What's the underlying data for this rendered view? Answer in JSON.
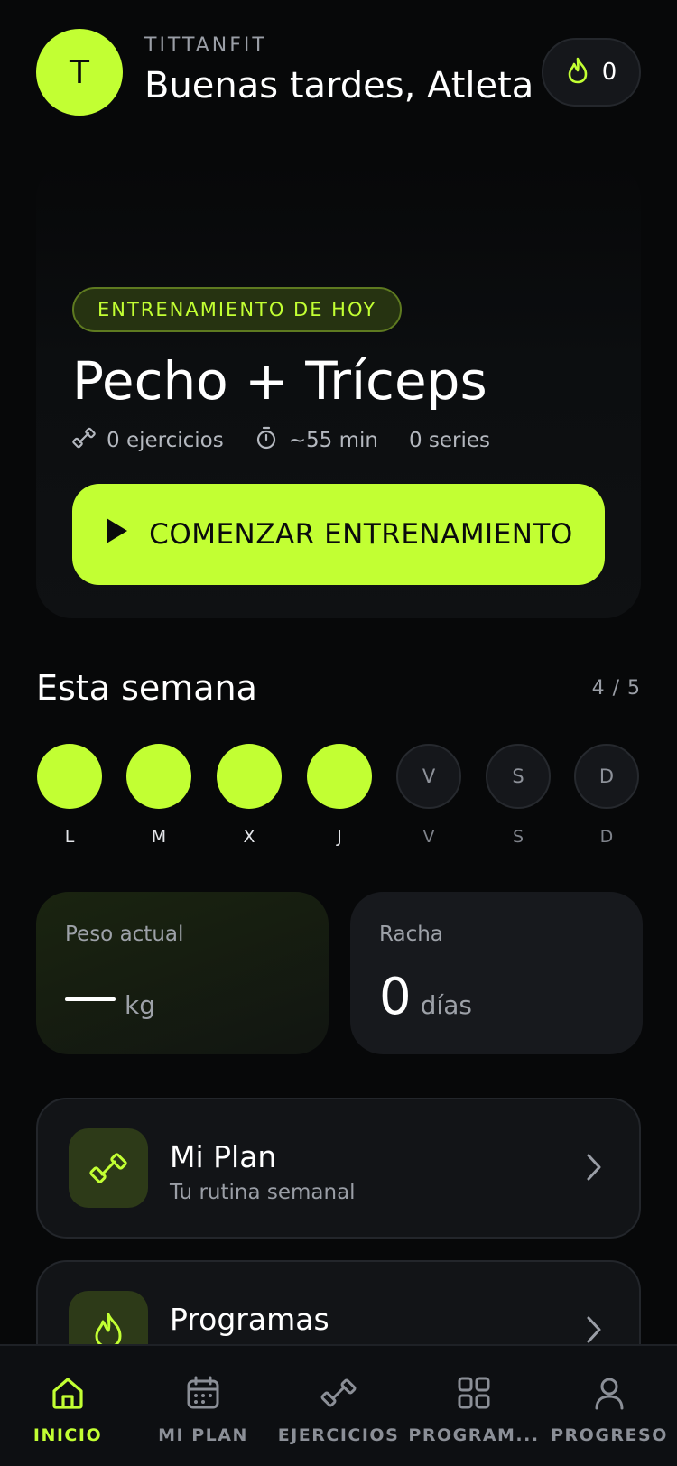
{
  "header": {
    "avatar_letter": "T",
    "brand": "TITTANFIT",
    "greeting": "Buenas tardes, Atleta",
    "streak_count": "0"
  },
  "hero": {
    "tag": "ENTRENAMIENTO DE HOY",
    "title": "Pecho + Tríceps",
    "exercises": "0 ejercicios",
    "duration": "~55 min",
    "series": "0 series",
    "start_button": "COMENZAR ENTRENAMIENTO"
  },
  "week": {
    "title": "Esta semana",
    "progress": "4 / 5",
    "days": [
      {
        "label": "L",
        "done": true,
        "circle_text": ""
      },
      {
        "label": "M",
        "done": true,
        "circle_text": ""
      },
      {
        "label": "X",
        "done": true,
        "circle_text": ""
      },
      {
        "label": "J",
        "done": true,
        "circle_text": ""
      },
      {
        "label": "V",
        "done": false,
        "circle_text": "V"
      },
      {
        "label": "S",
        "done": false,
        "circle_text": "S"
      },
      {
        "label": "D",
        "done": false,
        "circle_text": "D"
      }
    ]
  },
  "stats": {
    "weight_label": "Peso actual",
    "weight_unit": "kg",
    "streak_label": "Racha",
    "streak_value": "0",
    "streak_unit": "días"
  },
  "cards": {
    "plan_title": "Mi Plan",
    "plan_subtitle": "Tu rutina semanal",
    "programs_title": "Programas"
  },
  "nav": {
    "home": "INICIO",
    "plan": "MI PLAN",
    "exercises": "EJERCICIOS",
    "programs": "PROGRAM...",
    "progress": "PROGRESO"
  },
  "colors": {
    "accent": "#c2ff33",
    "background": "#070809",
    "card": "#121417"
  },
  "icons": [
    "flame-icon",
    "dumbbell-icon",
    "timer-icon",
    "play-icon",
    "chevron-right-icon",
    "home-icon",
    "calendar-icon",
    "grid-icon",
    "user-icon"
  ]
}
